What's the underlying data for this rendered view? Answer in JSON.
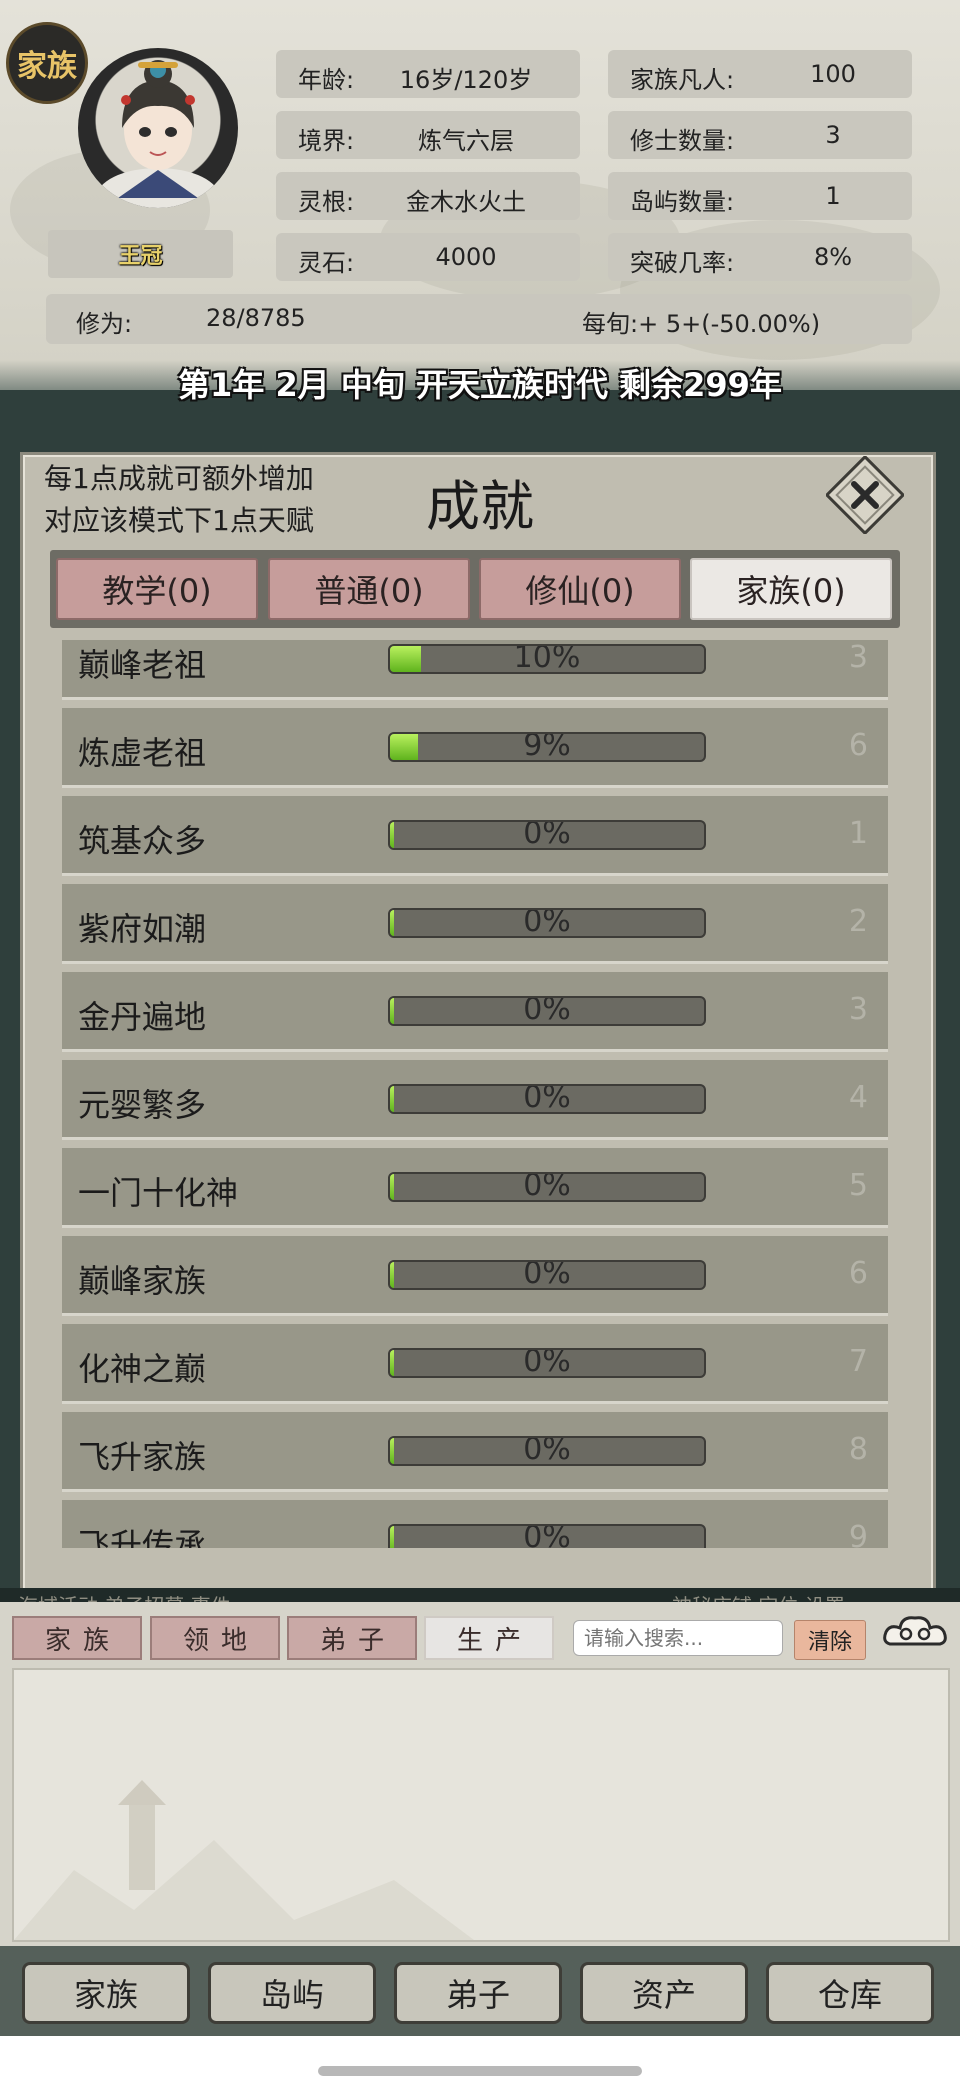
{
  "character": {
    "family_badge": "家族",
    "name": "王冠",
    "stats": [
      {
        "label": "年龄:",
        "value": "16岁/120岁"
      },
      {
        "label": "家族凡人:",
        "value": "100"
      },
      {
        "label": "境界:",
        "value": "炼气六层"
      },
      {
        "label": "修士数量:",
        "value": "3"
      },
      {
        "label": "灵根:",
        "value": "金木水火土"
      },
      {
        "label": "岛屿数量:",
        "value": "1"
      },
      {
        "label": "灵石:",
        "value": "4000"
      },
      {
        "label": "突破几率:",
        "value": "8%"
      }
    ],
    "cultivation_label": "修为:",
    "cultivation_value": "28/8785",
    "per_period": "每旬:+ 5+(-50.00%)"
  },
  "time_line": "第1年 2月 中旬  开天立族时代 剩余299年",
  "achievement": {
    "hint_line1": "每1点成就可额外增加",
    "hint_line2": "对应该模式下1点天赋",
    "title": "成就",
    "tabs": [
      {
        "label": "教学(0)",
        "active": false
      },
      {
        "label": "普通(0)",
        "active": false
      },
      {
        "label": "修仙(0)",
        "active": false
      },
      {
        "label": "家族(0)",
        "active": true
      }
    ],
    "items": [
      {
        "name": "巅峰老祖",
        "progress": 0.1,
        "percent": "10%",
        "reward": "3"
      },
      {
        "name": "炼虚老祖",
        "progress": 0.09,
        "percent": "9%",
        "reward": "6"
      },
      {
        "name": "筑基众多",
        "progress": 0,
        "percent": "0%",
        "reward": "1"
      },
      {
        "name": "紫府如潮",
        "progress": 0,
        "percent": "0%",
        "reward": "2"
      },
      {
        "name": "金丹遍地",
        "progress": 0,
        "percent": "0%",
        "reward": "3"
      },
      {
        "name": "元婴繁多",
        "progress": 0,
        "percent": "0%",
        "reward": "4"
      },
      {
        "name": "一门十化神",
        "progress": 0,
        "percent": "0%",
        "reward": "5"
      },
      {
        "name": "巅峰家族",
        "progress": 0,
        "percent": "0%",
        "reward": "6"
      },
      {
        "name": "化神之巅",
        "progress": 0,
        "percent": "0%",
        "reward": "7"
      },
      {
        "name": "飞升家族",
        "progress": 0,
        "percent": "0%",
        "reward": "8"
      },
      {
        "name": "飞升传承",
        "progress": 0,
        "percent": "0%",
        "reward": "9"
      }
    ]
  },
  "bottom": {
    "strip_left": "海域活动  弟子招募  事件",
    "strip_right": "神秘店铺  定位  设置",
    "tabs": [
      {
        "label": "家族",
        "active": false
      },
      {
        "label": "领地",
        "active": false
      },
      {
        "label": "弟子",
        "active": false
      },
      {
        "label": "生产",
        "active": true
      }
    ],
    "search_placeholder": "请输入搜索...",
    "clear_label": "清除",
    "cloud_icon": "auspicious-cloud-icon"
  },
  "nav": [
    "家族",
    "岛屿",
    "弟子",
    "资产",
    "仓库"
  ]
}
